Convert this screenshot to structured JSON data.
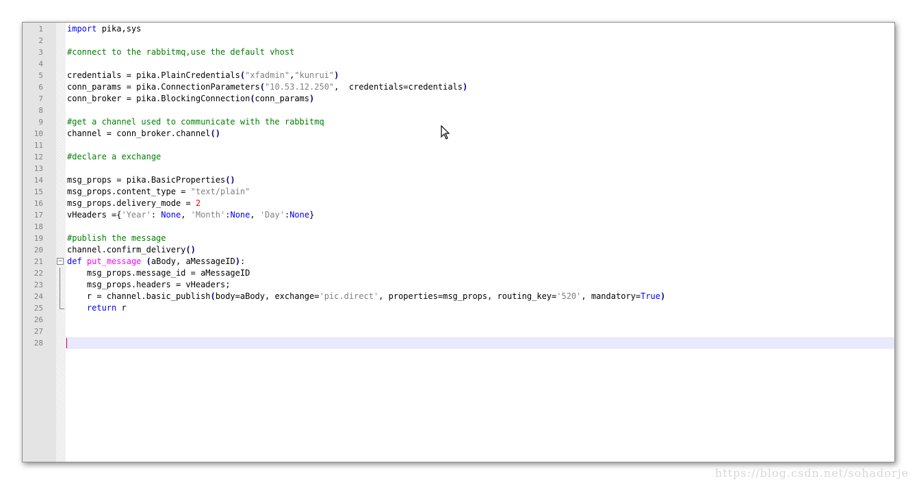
{
  "editor": {
    "lines": [
      {
        "n": "1",
        "t": [
          {
            "c": "kw",
            "v": "import"
          },
          {
            "c": "",
            "v": " pika,sys"
          }
        ]
      },
      {
        "n": "2",
        "t": []
      },
      {
        "n": "3",
        "t": [
          {
            "c": "cmt",
            "v": "#connect to the rabbitmq,use the default vhost"
          }
        ]
      },
      {
        "n": "4",
        "t": []
      },
      {
        "n": "5",
        "t": [
          {
            "c": "",
            "v": "credentials = pika.PlainCredentials"
          },
          {
            "c": "op",
            "v": "("
          },
          {
            "c": "str",
            "v": "\"xfadmin\""
          },
          {
            "c": "",
            "v": ","
          },
          {
            "c": "str",
            "v": "\"kunrui\""
          },
          {
            "c": "op",
            "v": ")"
          }
        ]
      },
      {
        "n": "6",
        "t": [
          {
            "c": "",
            "v": "conn_params = pika.ConnectionParameters"
          },
          {
            "c": "op",
            "v": "("
          },
          {
            "c": "str",
            "v": "\"10.53.12.250\""
          },
          {
            "c": "",
            "v": ",  credentials=credentials"
          },
          {
            "c": "op",
            "v": ")"
          }
        ]
      },
      {
        "n": "7",
        "t": [
          {
            "c": "",
            "v": "conn_broker = pika.BlockingConnection"
          },
          {
            "c": "op",
            "v": "("
          },
          {
            "c": "",
            "v": "conn_params"
          },
          {
            "c": "op",
            "v": ")"
          }
        ]
      },
      {
        "n": "8",
        "t": []
      },
      {
        "n": "9",
        "t": [
          {
            "c": "cmt",
            "v": "#get a channel used to communicate with the rabbitmq"
          }
        ]
      },
      {
        "n": "10",
        "t": [
          {
            "c": "",
            "v": "channel = conn_broker.channel"
          },
          {
            "c": "op",
            "v": "()"
          }
        ]
      },
      {
        "n": "11",
        "t": []
      },
      {
        "n": "12",
        "t": [
          {
            "c": "cmt",
            "v": "#declare a exchange"
          }
        ]
      },
      {
        "n": "13",
        "t": []
      },
      {
        "n": "14",
        "t": [
          {
            "c": "",
            "v": "msg_props = pika.BasicProperties"
          },
          {
            "c": "op",
            "v": "()"
          }
        ]
      },
      {
        "n": "15",
        "t": [
          {
            "c": "",
            "v": "msg_props.content_type = "
          },
          {
            "c": "str",
            "v": "\"text/plain\""
          }
        ]
      },
      {
        "n": "16",
        "t": [
          {
            "c": "",
            "v": "msg_props.delivery_mode = "
          },
          {
            "c": "num",
            "v": "2"
          }
        ]
      },
      {
        "n": "17",
        "t": [
          {
            "c": "",
            "v": "vHeaders ={"
          },
          {
            "c": "str",
            "v": "'Year'"
          },
          {
            "c": "",
            "v": ": "
          },
          {
            "c": "kw",
            "v": "None"
          },
          {
            "c": "",
            "v": ", "
          },
          {
            "c": "str",
            "v": "'Month'"
          },
          {
            "c": "",
            "v": ":"
          },
          {
            "c": "kw",
            "v": "None"
          },
          {
            "c": "",
            "v": ", "
          },
          {
            "c": "str",
            "v": "'Day'"
          },
          {
            "c": "",
            "v": ":"
          },
          {
            "c": "kw",
            "v": "None"
          },
          {
            "c": "",
            "v": "}"
          }
        ]
      },
      {
        "n": "18",
        "t": []
      },
      {
        "n": "19",
        "t": [
          {
            "c": "cmt",
            "v": "#publish the message"
          }
        ]
      },
      {
        "n": "20",
        "t": [
          {
            "c": "",
            "v": "channel.confirm_delivery"
          },
          {
            "c": "op",
            "v": "()"
          }
        ]
      },
      {
        "n": "21",
        "fold": "start",
        "t": [
          {
            "c": "kw",
            "v": "def"
          },
          {
            "c": "",
            "v": " "
          },
          {
            "c": "fn",
            "v": "put_message"
          },
          {
            "c": "",
            "v": " "
          },
          {
            "c": "op",
            "v": "("
          },
          {
            "c": "",
            "v": "aBody, aMessageID"
          },
          {
            "c": "op",
            "v": ")"
          },
          {
            "c": "",
            "v": ":"
          }
        ]
      },
      {
        "n": "22",
        "fold": "mid",
        "t": [
          {
            "c": "",
            "v": "    msg_props.message_id = aMessageID"
          }
        ]
      },
      {
        "n": "23",
        "fold": "mid",
        "t": [
          {
            "c": "",
            "v": "    msg_props.headers = vHeaders;"
          }
        ]
      },
      {
        "n": "24",
        "fold": "mid",
        "t": [
          {
            "c": "",
            "v": "    r = channel.basic_publish"
          },
          {
            "c": "op",
            "v": "("
          },
          {
            "c": "",
            "v": "body=aBody, exchange="
          },
          {
            "c": "str",
            "v": "'pic.direct'"
          },
          {
            "c": "",
            "v": ", properties=msg_props, routing_key="
          },
          {
            "c": "str",
            "v": "'520'"
          },
          {
            "c": "",
            "v": ", mandatory="
          },
          {
            "c": "kw",
            "v": "True"
          },
          {
            "c": "op",
            "v": ")"
          }
        ]
      },
      {
        "n": "25",
        "fold": "end",
        "t": [
          {
            "c": "",
            "v": "    "
          },
          {
            "c": "kw",
            "v": "return"
          },
          {
            "c": "",
            "v": " r"
          }
        ]
      },
      {
        "n": "26",
        "t": []
      },
      {
        "n": "27",
        "t": []
      },
      {
        "n": "28",
        "current": true,
        "t": []
      }
    ]
  },
  "icons": {
    "fold_toggle": "minus-box-icon",
    "cursor": "mouse-pointer-icon"
  },
  "colors": {
    "keyword": "#0000ff",
    "comment": "#008000",
    "string": "#808080",
    "number": "#ff0000",
    "function": "#ff00ff",
    "current_line": "#e8e8ff"
  },
  "watermark": "https://blog.csdn.net/sohadorje"
}
